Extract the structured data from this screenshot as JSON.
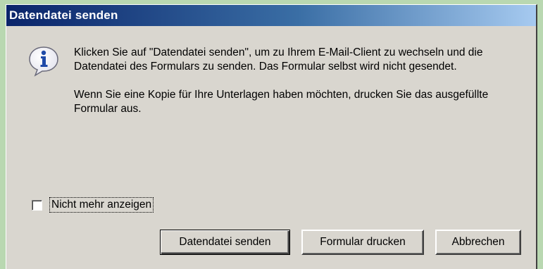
{
  "dialog": {
    "title": "Datendatei senden",
    "icon": "info-icon",
    "message_line1": "Klicken Sie auf \"Datendatei senden\", um zu Ihrem E-Mail-Client zu wechseln und die Datendatei des Formulars zu senden. Das Formular selbst wird nicht gesendet.",
    "message_line2": "Wenn Sie eine Kopie für Ihre Unterlagen haben möchten, drucken Sie das ausgefüllte Formular aus.",
    "checkbox_label": "Nicht mehr anzeigen",
    "checkbox_checked": false,
    "buttons": {
      "send": "Datendatei senden",
      "print": "Formular drucken",
      "cancel": "Abbrechen"
    }
  },
  "colors": {
    "titlebar_start": "#0a246a",
    "titlebar_end": "#a6caf0",
    "dialog_bg": "#d9d6cf",
    "frame_bg": "#b9d8b1"
  }
}
